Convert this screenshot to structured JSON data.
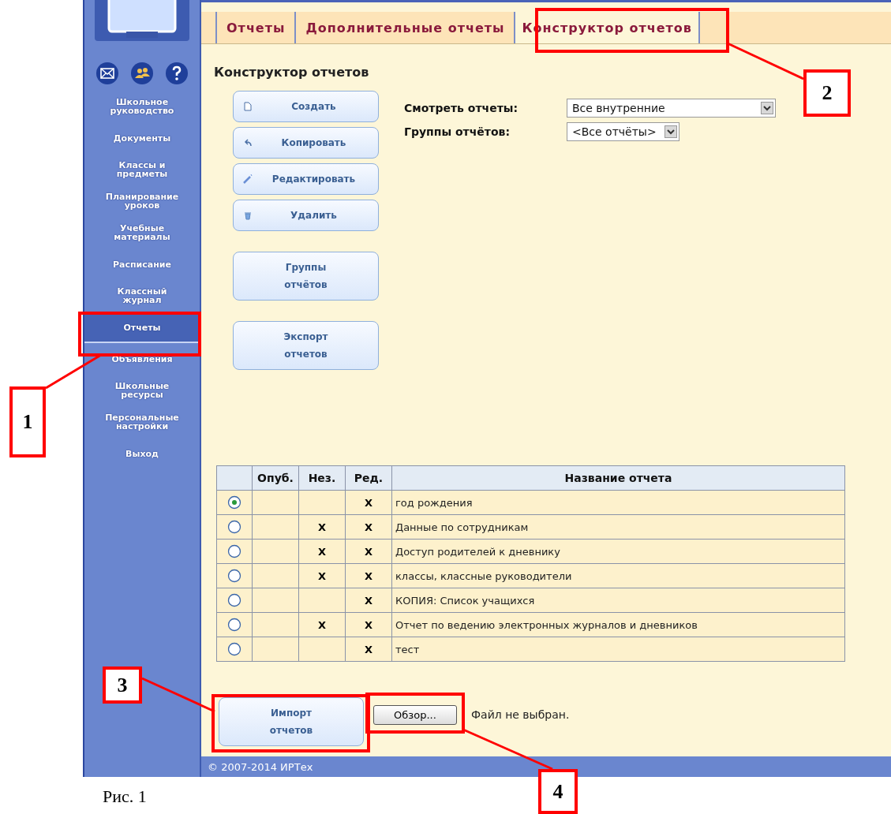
{
  "sidebar": {
    "items": [
      {
        "label": "Школьное руководство",
        "selected": false
      },
      {
        "label": "Документы",
        "selected": false
      },
      {
        "label": "Классы и предметы",
        "selected": false
      },
      {
        "label": "Планирование уроков",
        "selected": false
      },
      {
        "label": "Учебные материалы",
        "selected": false
      },
      {
        "label": "Расписание",
        "selected": false
      },
      {
        "label": "Классный журнал",
        "selected": false
      },
      {
        "label": "Отчеты",
        "selected": true
      },
      {
        "label": "Объявления",
        "selected": false
      },
      {
        "label": "Школьные ресурсы",
        "selected": false
      },
      {
        "label": "Персональные настройки",
        "selected": false
      },
      {
        "label": "Выход",
        "selected": false
      }
    ]
  },
  "tabs": [
    {
      "label": "Отчеты",
      "selected": false
    },
    {
      "label": "Дополнительные отчеты",
      "selected": false
    },
    {
      "label": "Конструктор отчетов",
      "selected": true
    }
  ],
  "page_title": "Конструктор отчетов",
  "buttons": [
    {
      "label": "Создать",
      "kind": "new"
    },
    {
      "label": "Копировать",
      "kind": "copy"
    },
    {
      "label": "Редактировать",
      "kind": "edit"
    },
    {
      "label": "Удалить",
      "kind": "delete"
    },
    {
      "label": "Группы отчётов",
      "kind": "large"
    },
    {
      "label": "Экспорт отчетов",
      "kind": "large"
    }
  ],
  "filters": [
    {
      "label": "Смотреть отчеты:",
      "value": "Все внутренние"
    },
    {
      "label": "Группы отчётов:",
      "value": "<Все отчёты>"
    }
  ],
  "table": {
    "columns": [
      "Опуб.",
      "Нез.",
      "Ред.",
      "Название отчета"
    ],
    "rows": [
      {
        "selected": true,
        "red": "X",
        "name": "год рождения"
      },
      {
        "selected": false,
        "nez": "X",
        "red": "X",
        "name": "Данные по сотрудникам"
      },
      {
        "selected": false,
        "nez": "X",
        "red": "X",
        "name": "Доступ родителей к дневнику"
      },
      {
        "selected": false,
        "nez": "X",
        "red": "X",
        "name": "классы, классные руководители"
      },
      {
        "selected": false,
        "red": "X",
        "name": "КОПИЯ: Список учащихся"
      },
      {
        "selected": false,
        "nez": "X",
        "red": "X",
        "name": "Отчет по ведению электронных журналов и дневников"
      },
      {
        "selected": false,
        "red": "X",
        "name": "тест"
      }
    ]
  },
  "import": {
    "button": "Импорт отчетов",
    "browse_button": "Обзор...",
    "file_status": "Файл не выбран."
  },
  "footer": "© 2007-2014 ИРТех",
  "callouts": [
    "1",
    "2",
    "3",
    "4"
  ],
  "caption": "Рис. 1"
}
